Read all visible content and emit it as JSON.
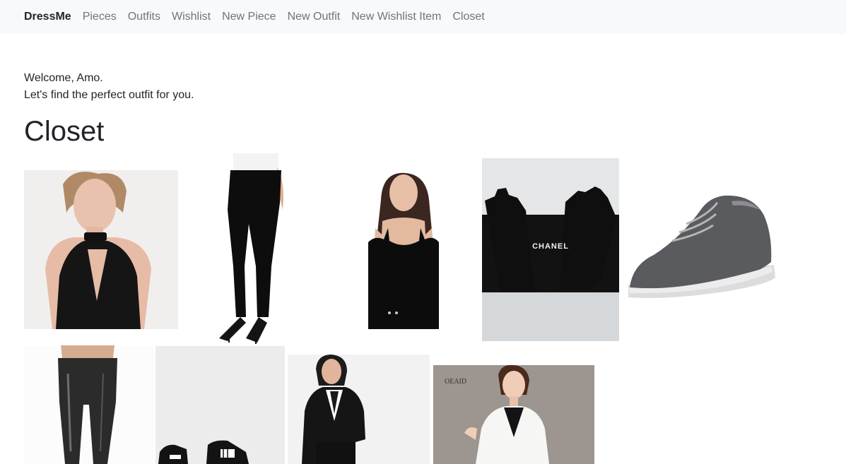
{
  "navbar": {
    "brand": "DressMe",
    "links": [
      "Pieces",
      "Outfits",
      "Wishlist",
      "New Piece",
      "New Outfit",
      "New Wishlist Item",
      "Closet"
    ]
  },
  "welcome": {
    "greeting": "Welcome, Amo.",
    "subtitle": "Let's find the perfect outfit for you."
  },
  "page_title": "Closet",
  "closet": {
    "box_label": "CHANEL",
    "blazer_label": "OEAID"
  }
}
